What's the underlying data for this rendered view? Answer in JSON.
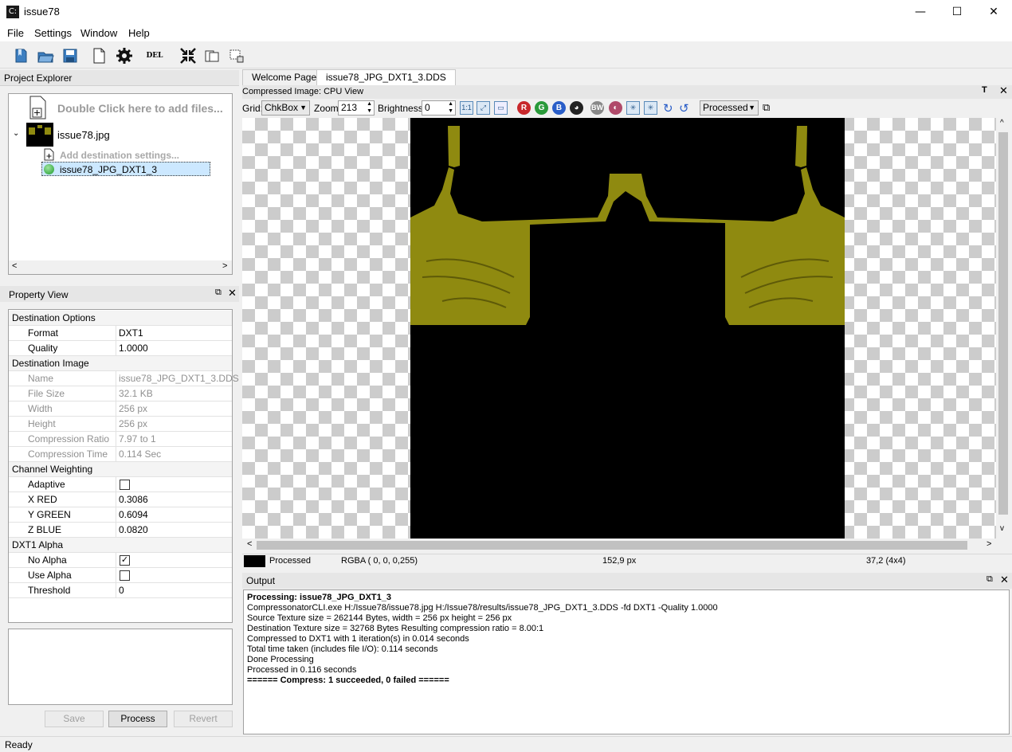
{
  "window": {
    "title": "issue78",
    "app_icon": "C:",
    "minimize": "—",
    "maximize": "☐",
    "close": "✕"
  },
  "menu": [
    "File",
    "Settings",
    "Window",
    "Help"
  ],
  "toolbar": {
    "del_label": "DEL"
  },
  "project_explorer": {
    "title": "Project Explorer",
    "add_files": "Double Click here to add files...",
    "image_name": "issue78.jpg",
    "add_destination": "Add destination settings...",
    "selected_item": "issue78_JPG_DXT1_3"
  },
  "property_view": {
    "title": "Property View",
    "rows": [
      {
        "type": "group",
        "key": "Destination Options"
      },
      {
        "type": "row",
        "key": "Format",
        "value": "DXT1"
      },
      {
        "type": "row",
        "key": "Quality",
        "value": "1.0000"
      },
      {
        "type": "group",
        "key": "Destination Image"
      },
      {
        "type": "dis",
        "key": "Name",
        "value": "issue78_JPG_DXT1_3.DDS"
      },
      {
        "type": "dis",
        "key": "File Size",
        "value": "32.1 KB"
      },
      {
        "type": "dis",
        "key": "Width",
        "value": "256 px"
      },
      {
        "type": "dis",
        "key": "Height",
        "value": "256 px"
      },
      {
        "type": "dis",
        "key": "Compression Ratio",
        "value": "7.97 to 1"
      },
      {
        "type": "dis",
        "key": "Compression Time",
        "value": "0.114 Sec"
      },
      {
        "type": "group",
        "key": "Channel Weighting"
      },
      {
        "type": "check",
        "key": "Adaptive",
        "checked": false
      },
      {
        "type": "row",
        "key": "X RED",
        "value": "0.3086"
      },
      {
        "type": "row",
        "key": "Y GREEN",
        "value": "0.6094"
      },
      {
        "type": "row",
        "key": "Z BLUE",
        "value": "0.0820"
      },
      {
        "type": "group",
        "key": "DXT1 Alpha"
      },
      {
        "type": "check",
        "key": "No Alpha",
        "checked": true
      },
      {
        "type": "check",
        "key": "Use Alpha",
        "checked": false
      },
      {
        "type": "row",
        "key": "Threshold",
        "value": "0"
      }
    ],
    "buttons": {
      "save": "Save",
      "process": "Process",
      "revert": "Revert"
    }
  },
  "tabs": [
    "Welcome Page",
    "issue78_JPG_DXT1_3.DDS"
  ],
  "image_view": {
    "title": "Compressed Image: CPU View",
    "grid_label": "Grid:",
    "grid_value": "ChkBox",
    "zoom_label": "Zoom:",
    "zoom_value": "213",
    "brightness_label": "Brightness:",
    "brightness_value": "0",
    "view_mode": "Processed",
    "channel_buttons": [
      "R",
      "G",
      "B"
    ]
  },
  "pixel_status": {
    "swatch_color": "#000000",
    "label": "Processed",
    "rgba": "RGBA ( 0,  0,  0,255)",
    "pixel_pos": "152,9 px",
    "block_pos": "37,2 (4x4)"
  },
  "output": {
    "title": "Output",
    "lines": [
      {
        "text": "Processing: issue78_JPG_DXT1_3",
        "bold": true
      },
      {
        "text": "CompressonatorCLI.exe  H:/Issue78/issue78.jpg  H:/Issue78/results/issue78_JPG_DXT1_3.DDS  -fd DXT1  -Quality 1.0000",
        "bold": false
      },
      {
        "text": "Source Texture size = 262144 Bytes, width = 256 px  height = 256 px",
        "bold": false
      },
      {
        "text": "Destination Texture size = 32768 Bytes   Resulting compression ratio = 8.00:1",
        "bold": false
      },
      {
        "text": "Compressed to DXT1 with 1 iteration(s) in 0.014 seconds",
        "bold": false
      },
      {
        "text": "Total time taken (includes file I/O): 0.114 seconds",
        "bold": false
      },
      {
        "text": "Done Processing",
        "bold": false
      },
      {
        "text": "Processed in 0.116 seconds",
        "bold": false
      },
      {
        "text": "====== Compress: 1 succeeded, 0 failed ======",
        "bold": true
      }
    ]
  },
  "status_bar": {
    "text": "Ready"
  },
  "colors": {
    "image_tint": "#8f8a10",
    "image_bg": "#000000",
    "selection": "#cce8ff"
  }
}
